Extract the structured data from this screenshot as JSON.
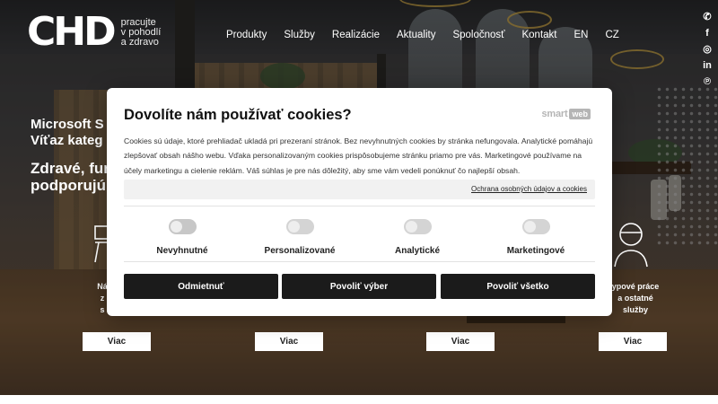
{
  "header": {
    "logo_mark": "CHD",
    "logo_tagline": [
      "pracujte",
      "v pohodlí",
      "a zdravo"
    ],
    "nav": [
      "Produkty",
      "Služby",
      "Realizácie",
      "Aktuality",
      "Spoločnosť",
      "Kontakt",
      "EN",
      "CZ"
    ]
  },
  "social": {
    "icons": [
      "phone-icon",
      "facebook-icon",
      "instagram-icon",
      "linkedin-icon",
      "pinterest-icon"
    ],
    "glyphs": [
      "✆",
      "f",
      "◎",
      "in",
      "℗"
    ]
  },
  "hero": {
    "line1": "Microsoft S",
    "line2": "Víťaz kateg",
    "line3": "Zdravé, fun",
    "line4": "podporujú"
  },
  "services": {
    "labels": [
      "Ná",
      "z",
      "s",
      "ypové práce",
      "a ostatné",
      "služby"
    ],
    "viac_label": "Viac"
  },
  "cookie": {
    "title": "Dovolíte nám používať cookies?",
    "brand_smart": "smart",
    "brand_web": "web",
    "body": "Cookies sú údaje, ktoré prehliadač ukladá pri prezeraní stránok. Bez nevyhnutných cookies by stránka nefungovala. Analytické pomáhajú zlepšovať obsah nášho webu. Vďaka personalizovaným cookies prispôsobujeme stránku priamo pre vás. Marketingové používame na účely marketingu a cielenie reklám. Váš súhlas je pre nás dôležitý, aby sme vám vedeli ponúknuť čo najlepší obsah.",
    "privacy_link": "Ochrana osobných údajov a cookies",
    "toggles": [
      {
        "label": "Nevyhnutné",
        "on": true,
        "disabled": true
      },
      {
        "label": "Personalizované",
        "on": false,
        "disabled": false
      },
      {
        "label": "Analytické",
        "on": false,
        "disabled": false
      },
      {
        "label": "Marketingové",
        "on": false,
        "disabled": false
      }
    ],
    "buttons": {
      "reject": "Odmietnuť",
      "select": "Povoliť výber",
      "accept_all": "Povoliť všetko"
    }
  },
  "colors": {
    "modal_bg": "#ffffff",
    "button_bg": "#1b1b1b",
    "toggle_off": "#d4d4d4"
  }
}
